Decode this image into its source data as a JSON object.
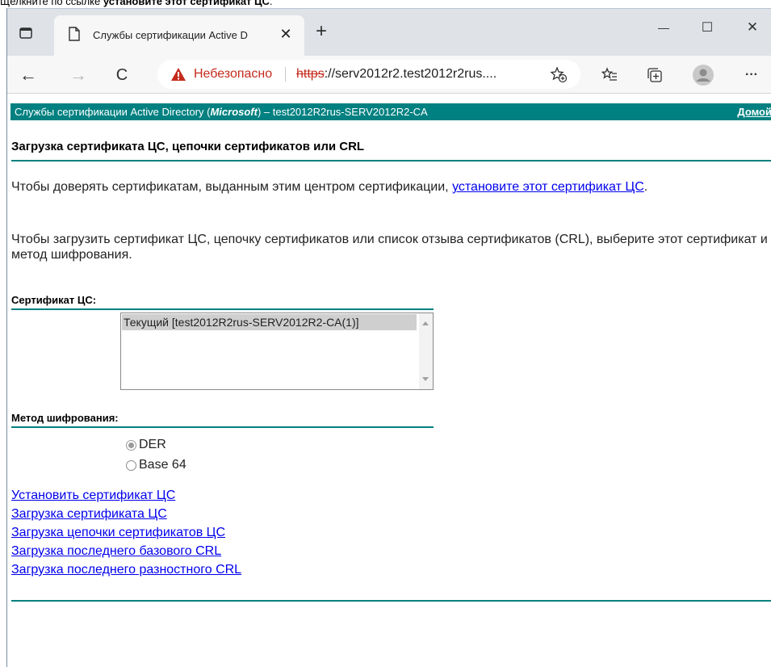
{
  "caption": {
    "prefix": "Щелкните по ссылке ",
    "bold": "установите этот сертификат ЦС",
    "suffix": "."
  },
  "browser": {
    "tab_title": "Службы сертификации Active D",
    "close_glyph": "✕",
    "new_tab_glyph": "+",
    "minimize_glyph": "—",
    "maximize_glyph": "☐",
    "close_window_glyph": "✕",
    "back_glyph": "←",
    "forward_glyph": "→",
    "refresh_glyph": "C",
    "more_glyph": "···",
    "security_label": "Небезопасно",
    "url_scheme": "https",
    "url_rest": "://serv2012r2.test2012r2rus....",
    "warning_color": "#c42b1c"
  },
  "page": {
    "header_prefix": "Службы сертификации Active Directory (",
    "header_brand": "Microsoft",
    "header_suffix": ")  –  test2012R2rus-SERV2012R2-CA",
    "home_link": "Домой",
    "accent_color": "#008080",
    "heading": "Загрузка сертификата ЦС, цепочки сертификатов или CRL",
    "para1_text": "Чтобы доверять сертификатам, выданным этим центром сертификации, ",
    "para1_link": "установите этот сертификат ЦС",
    "para1_end": ".",
    "para2": "Чтобы загрузить сертификат ЦС, цепочку сертификатов или список отзыва сертификатов (CRL), выберите этот сертификат и метод шифрования.",
    "cert_label": "Сертификат ЦС:",
    "cert_selected": "Текущий [test2012R2rus-SERV2012R2-CA(1)]",
    "encoding_label": "Метод шифрования:",
    "encoding_options": [
      "DER",
      "Base 64"
    ],
    "encoding_selected": "DER",
    "links": [
      "Установить сертификат ЦС",
      "Загрузка сертификата ЦС",
      "Загрузка цепочки сертификатов ЦС",
      "Загрузка последнего базового CRL",
      "Загрузка последнего разностного CRL"
    ]
  }
}
